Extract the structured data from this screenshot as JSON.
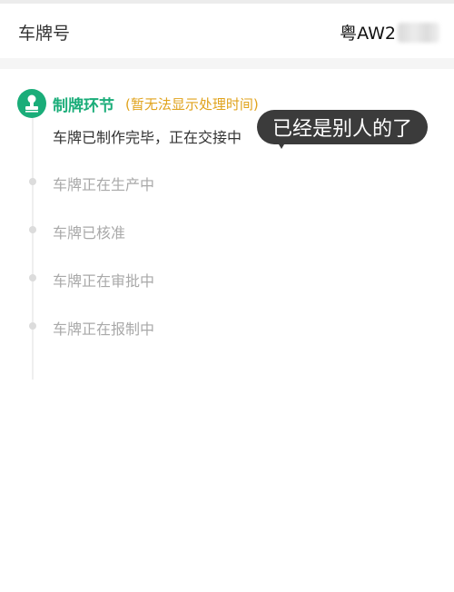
{
  "plate": {
    "label": "车牌号",
    "value_visible": "粤AW2"
  },
  "timeline": {
    "current": {
      "title": "制牌环节",
      "note": "(暂无法显示处理时间)",
      "description": "车牌已制作完毕，正在交接中"
    },
    "bubble": "已经是别人的了",
    "steps": [
      {
        "label": "车牌正在生产中"
      },
      {
        "label": "车牌已核准"
      },
      {
        "label": "车牌正在审批中"
      },
      {
        "label": "车牌正在报制中"
      }
    ]
  },
  "colors": {
    "accent": "#1aad79",
    "note": "#e0a31d",
    "bubble_bg": "#3b3b3b"
  }
}
